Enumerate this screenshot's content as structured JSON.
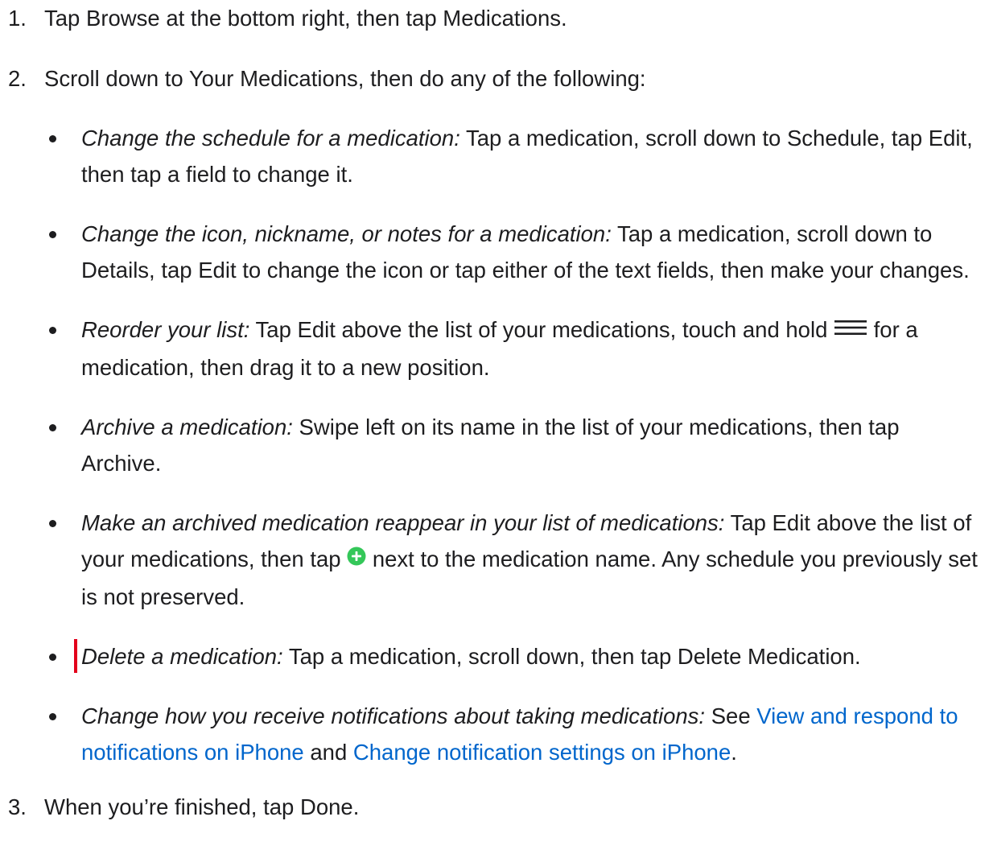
{
  "steps": [
    {
      "number": "1.",
      "text": "Tap Browse at the bottom right, then tap Medications."
    },
    {
      "number": "2.",
      "text": "Scroll down to Your Medications, then do any of the following:",
      "options": [
        {
          "title": "Change the schedule for a medication:",
          "body": " Tap a medication, scroll down to Schedule, tap Edit, then tap a field to change it."
        },
        {
          "title": "Change the icon, nickname, or notes for a medication:",
          "body": " Tap a medication, scroll down to Details, tap Edit to change the icon or tap either of the text fields, then make your changes."
        },
        {
          "title": "Reorder your list:",
          "body_before": " Tap Edit above the list of your medications, touch and hold ",
          "icon": "reorder-handle-icon",
          "body_after": " for a medication, then drag it to a new position."
        },
        {
          "title": "Archive a medication:",
          "body": " Swipe left on its name in the list of your medications, then tap Archive."
        },
        {
          "title": "Make an archived medication reappear in your list of medications:",
          "body_before": " Tap Edit above the list of your medications, then tap ",
          "icon": "add-circle-icon",
          "body_after": " next to the medication name. Any schedule you previously set is not preserved."
        },
        {
          "title": "Delete a medication:",
          "body": " Tap a medication, scroll down, then tap Delete Medication."
        },
        {
          "title": "Change how you receive notifications about taking medications:",
          "body_see": " See ",
          "link1": "View and respond to notifications on iPhone",
          "and": " and ",
          "link2": "Change notification settings on iPhone",
          "end": "."
        }
      ]
    },
    {
      "number": "3.",
      "text": "When you’re finished, tap Done."
    }
  ],
  "colors": {
    "text": "#1d1d1f",
    "link": "#0066cc",
    "add_icon": "#34c759",
    "caret": "#e3001b"
  }
}
